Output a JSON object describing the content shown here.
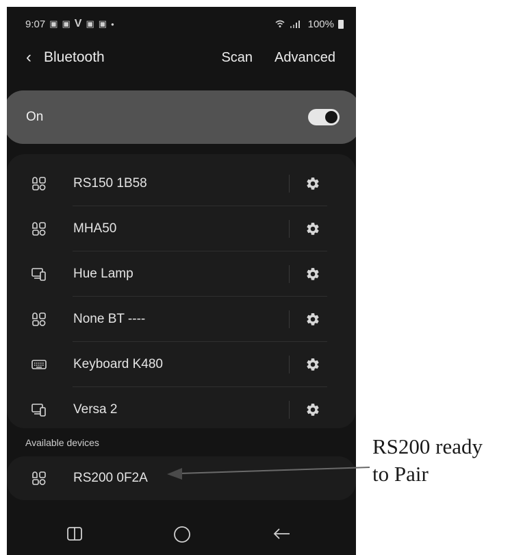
{
  "status_bar": {
    "time": "9:07",
    "battery": "100%"
  },
  "app_bar": {
    "title": "Bluetooth",
    "scan_label": "Scan",
    "advanced_label": "Advanced"
  },
  "toggle": {
    "label": "On",
    "state": true
  },
  "paired_devices": [
    {
      "name": "RS150 1B58",
      "icon": "hearing-aid-icon"
    },
    {
      "name": "MHA50",
      "icon": "hearing-aid-icon"
    },
    {
      "name": "Hue Lamp",
      "icon": "device-icon"
    },
    {
      "name": "None BT ----",
      "icon": "hearing-aid-icon"
    },
    {
      "name": "Keyboard K480",
      "icon": "keyboard-icon"
    },
    {
      "name": "Versa 2",
      "icon": "device-icon"
    }
  ],
  "available_section": {
    "header": "Available devices"
  },
  "available_devices": [
    {
      "name": "RS200 0F2A",
      "icon": "hearing-aid-icon"
    }
  ],
  "annotation": {
    "line1": "RS200 ready",
    "line2": "to Pair"
  },
  "colors": {
    "background": "#141414",
    "card": "#1c1c1c",
    "toggle_card": "#525252",
    "text": "#e4e4e4"
  }
}
